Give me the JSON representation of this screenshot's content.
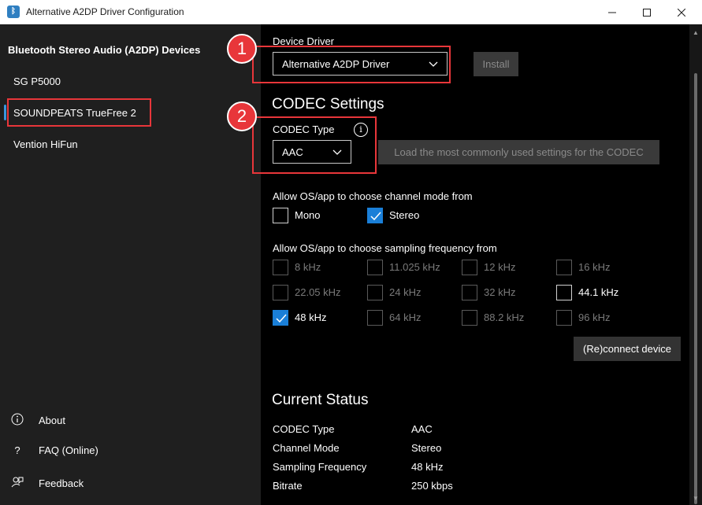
{
  "window": {
    "title": "Alternative A2DP Driver Configuration",
    "icon": "bluetooth-app-icon"
  },
  "sidebar": {
    "heading": "Bluetooth Stereo Audio (A2DP) Devices",
    "devices": [
      {
        "label": "SG P5000",
        "selected": false
      },
      {
        "label": "SOUNDPEATS TrueFree 2",
        "selected": true
      },
      {
        "label": "Vention HiFun",
        "selected": false
      }
    ],
    "footer": [
      {
        "label": "About",
        "icon": "info-icon"
      },
      {
        "label": "FAQ (Online)",
        "icon": "question-icon"
      },
      {
        "label": "Feedback",
        "icon": "feedback-icon"
      }
    ]
  },
  "driver": {
    "label": "Device Driver",
    "selected": "Alternative A2DP Driver",
    "install_label": "Install"
  },
  "codec": {
    "heading": "CODEC Settings",
    "type_label": "CODEC Type",
    "selected": "AAC",
    "load_button": "Load the most commonly used settings for the CODEC"
  },
  "channel_mode": {
    "label": "Allow OS/app to choose channel mode from",
    "options": [
      {
        "label": "Mono",
        "checked": false,
        "enabled": true
      },
      {
        "label": "Stereo",
        "checked": true,
        "enabled": true
      }
    ]
  },
  "sampling": {
    "label": "Allow OS/app to choose sampling frequency from",
    "options": [
      {
        "label": "8 kHz",
        "checked": false,
        "enabled": false
      },
      {
        "label": "11.025 kHz",
        "checked": false,
        "enabled": false
      },
      {
        "label": "12 kHz",
        "checked": false,
        "enabled": false
      },
      {
        "label": "16 kHz",
        "checked": false,
        "enabled": false
      },
      {
        "label": "22.05 kHz",
        "checked": false,
        "enabled": false
      },
      {
        "label": "24 kHz",
        "checked": false,
        "enabled": false
      },
      {
        "label": "32 kHz",
        "checked": false,
        "enabled": false
      },
      {
        "label": "44.1 kHz",
        "checked": false,
        "enabled": true
      },
      {
        "label": "48 kHz",
        "checked": true,
        "enabled": true
      },
      {
        "label": "64 kHz",
        "checked": false,
        "enabled": false
      },
      {
        "label": "88.2 kHz",
        "checked": false,
        "enabled": false
      },
      {
        "label": "96 kHz",
        "checked": false,
        "enabled": false
      }
    ]
  },
  "reconnect_label": "(Re)connect device",
  "status": {
    "heading": "Current Status",
    "rows": [
      {
        "key": "CODEC Type",
        "value": "AAC"
      },
      {
        "key": "Channel Mode",
        "value": "Stereo"
      },
      {
        "key": "Sampling Frequency",
        "value": "48 kHz"
      },
      {
        "key": "Bitrate",
        "value": "250 kbps"
      }
    ]
  },
  "annotations": [
    "1",
    "2"
  ],
  "colors": {
    "accent": "#1a7fd8",
    "annotation_red": "#e8363a",
    "sidebar_bg": "#1f1f1f",
    "content_bg": "#000000"
  }
}
